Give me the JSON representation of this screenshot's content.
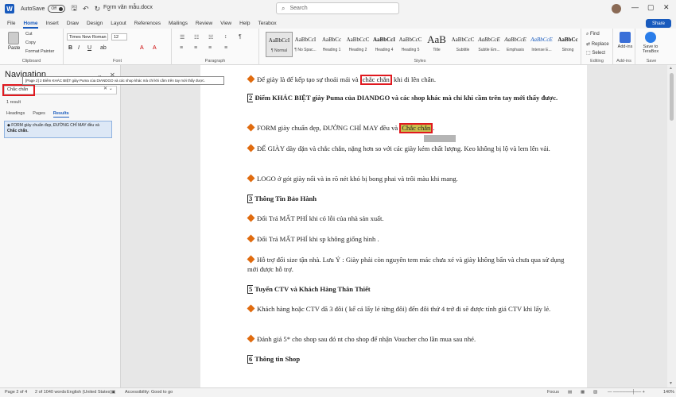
{
  "titlebar": {
    "autosave_label": "AutoSave",
    "autosave_state": "Off",
    "doc_title": "Form văn mẫu.docx",
    "search_placeholder": "Search"
  },
  "menu": {
    "tabs": [
      "File",
      "Home",
      "Insert",
      "Draw",
      "Design",
      "Layout",
      "References",
      "Mailings",
      "Review",
      "View",
      "Help",
      "Terabox"
    ],
    "active": "Home",
    "share_label": "Share"
  },
  "ribbon": {
    "clipboard": {
      "paste": "Paste",
      "cut": "Cut",
      "copy": "Copy",
      "format_painter": "Format Painter",
      "group_label": "Clipboard"
    },
    "font": {
      "name": "Times New Roman",
      "size": "12",
      "group_label": "Font"
    },
    "paragraph": {
      "group_label": "Paragraph"
    },
    "styles": {
      "group_label": "Styles",
      "items": [
        {
          "sample": "AaBbCcI",
          "name": "¶ Normal"
        },
        {
          "sample": "AaBbCcI",
          "name": "¶ No Spac..."
        },
        {
          "sample": "AaBbCc",
          "name": "Heading 1"
        },
        {
          "sample": "AaBbCcC",
          "name": "Heading 2"
        },
        {
          "sample": "AaBbCcI",
          "name": "Heading 4"
        },
        {
          "sample": "AaBbCcC",
          "name": "Heading 5"
        },
        {
          "sample": "AaB",
          "name": "Title"
        },
        {
          "sample": "AaBbCcC",
          "name": "Subtitle"
        },
        {
          "sample": "AaBbCcE",
          "name": "Subtle Em..."
        },
        {
          "sample": "AaBbCcE",
          "name": "Emphasis"
        },
        {
          "sample": "AaBbCcE",
          "name": "Intense E..."
        },
        {
          "sample": "AaBbCc",
          "name": "Strong"
        }
      ]
    },
    "editing": {
      "find": "Find",
      "replace": "Replace",
      "select": "Select",
      "group_label": "Editing"
    },
    "addins": {
      "label": "Add-ins",
      "group_label": "Add-ins"
    },
    "save": {
      "label": "Save to TeraBox",
      "group_label": "Save"
    }
  },
  "navigation": {
    "title": "Navigation",
    "search_value": "Chắc chắn",
    "result_count": "1 result",
    "tabs": [
      "Headings",
      "Pages",
      "Results"
    ],
    "active_tab": "Results",
    "result_text_prefix": "FORM giày chuẩn đẹp, ĐƯỜNG CHỈ MAY đều và",
    "result_text_match": "Chắc chắn.",
    "tooltip": "[Page 2] 2 Điểm KHÁC BIỆT giày Puma của DIANDGO và các shop khác mà chỉ khi cầm trên tay mới thấy được."
  },
  "document": {
    "p1_pre": "Để giày là để kếp tạo sự thoải mái và ",
    "p1_hl": "chắc chắn",
    "p1_post": " khi đi lên chân.",
    "h2_num": "2",
    "h2_text": " Điểm KHÁC BIỆT giày Puma của DIANDGO và các shop khác mà chỉ khi cầm trên tay mới thấy được.",
    "p2_pre": "FORM giày chuẩn đẹp, ĐƯỜNG CHỈ MAY đều và ",
    "p2_hl": "Chắc chắn",
    "p2_post": ".",
    "p3": "ĐẾ GIÀY dày dặn và chắc chắn, nặng hơn so với các giày kém chất lượng. Keo không bị lộ và lem lên vải.",
    "p4": "LOGO ở gót giày nổi và in rõ nét khó bị bong phai và trôi màu khi mang.",
    "h3_num": "3",
    "h3_text": " Thông Tin Bảo Hành",
    "p5": "Đổi Trả MẤT PHÍ khi có lỗi của nhà sản xuất.",
    "p6": "Đổi Trả MẤT PHÍ khi sp không giống hình .",
    "p7": "Hỗ trợ đổi size tận nhà. Lưu Ý : Giày phải còn nguyên tem mác chưa xé và giày không bẩn và chưa qua sử dụng mới được hỗ trợ.",
    "h5_num": "5",
    "h5_text": " Tuyển CTV và Khách Hàng Thân Thiết",
    "p8": "Khách hàng hoặc CTV đã 3 đôi ( kể cả lấy lẻ từng đôi) đến đôi thứ 4 trở đi sẽ được tính giá CTV khi lấy lẻ.",
    "p9": "Đánh giá 5* cho shop sau đó nt cho shop để nhận Voucher cho lần mua sau nhé.",
    "h6_num": "6",
    "h6_text": " Thông tin Shop"
  },
  "status": {
    "page": "Page 2 of 4",
    "words": "2 of 1040 words",
    "language": "English (United States)",
    "accessibility": "Accessibility: Good to go",
    "focus": "Focus",
    "zoom": "140%"
  },
  "colors": {
    "accent": "#185abd",
    "highlight_box": "#e0191f",
    "search_highlight": "#c9be4c",
    "bullet": "#e06b0f"
  }
}
